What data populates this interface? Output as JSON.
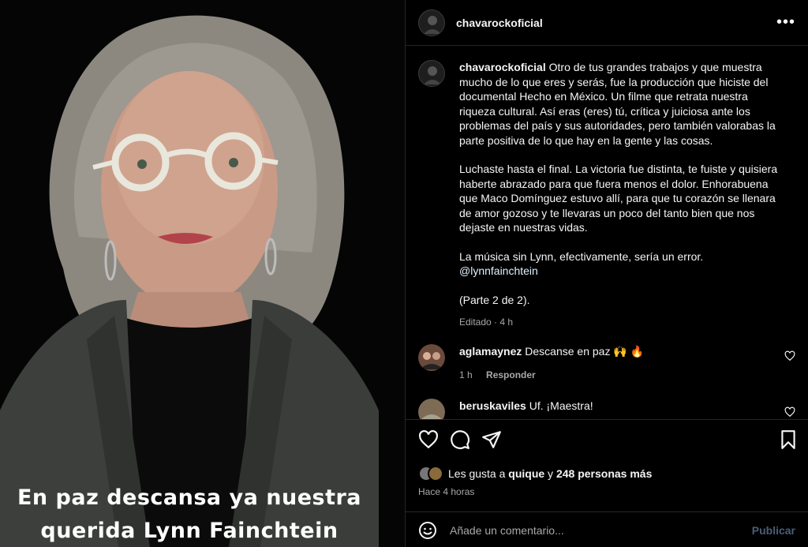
{
  "image": {
    "caption_line1": "En paz descansa ya nuestra",
    "caption_line2": "querida Lynn Fainchtein"
  },
  "header": {
    "username": "chavarockoficial",
    "more_icon": "more-horizontal-icon"
  },
  "post": {
    "author": "chavarockoficial",
    "paragraph1": "Otro de tus grandes trabajos y que muestra mucho de lo que eres y serás, fue la producción que hiciste del documental Hecho en México. Un filme que retrata nuestra riqueza cultural. Así eras (eres) tú, crítica y juiciosa ante los problemas del país y sus autoridades, pero también valorabas la parte positiva de lo que hay en la gente y las cosas.",
    "paragraph2": "Luchaste hasta el final. La victoria fue distinta, te fuiste y quisiera haberte abrazado para que fuera menos el dolor. Enhorabuena que Maco Domínguez estuvo allí, para que tu corazón se llenara de amor gozoso y te llevaras un poco del tanto bien que nos dejaste en nuestras vidas.",
    "paragraph3": "La música sin Lynn, efectivamente, sería un error.",
    "mention": "@lynnfainchtein",
    "paragraph4": "(Parte 2 de 2).",
    "edited": "Editado · 4 h"
  },
  "comments": [
    {
      "user": "aglamaynez",
      "text": "Descanse en paz 🙌 🔥",
      "time": "1 h",
      "reply": "Responder"
    },
    {
      "user": "beruskaviles",
      "text": "Uf. ¡Maestra!"
    }
  ],
  "actions": {
    "likes_prefix": "Les gusta a ",
    "likes_user": "quique",
    "likes_mid": " y ",
    "likes_count": "248 personas más",
    "time": "Hace 4 horas"
  },
  "composer": {
    "placeholder": "Añade un comentario...",
    "publish": "Publicar"
  }
}
